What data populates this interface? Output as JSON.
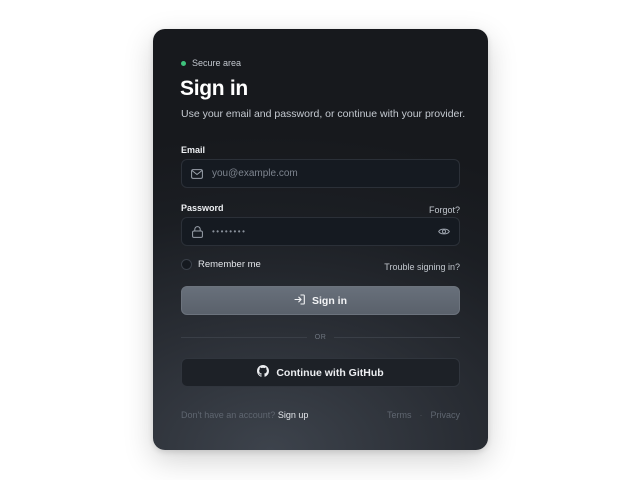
{
  "badge": {
    "text": "Secure area",
    "color": "#3ec27c"
  },
  "heading": {
    "title": "Sign in",
    "subtitle": "Use your email and password, or continue with your provider."
  },
  "email": {
    "label": "Email",
    "placeholder": "you@example.com",
    "value": "",
    "icon": "mail-icon"
  },
  "password": {
    "label": "Password",
    "forgot": "Forgot?",
    "masked": "••••••••",
    "icon": "lock-icon",
    "toggle_icon": "eye-icon"
  },
  "options": {
    "remember": "Remember me",
    "trouble": "Trouble signing in?"
  },
  "primary": {
    "label": "Sign in",
    "icon": "sign-in-icon"
  },
  "divider": {
    "text": "OR"
  },
  "github": {
    "label": "Continue with GitHub",
    "icon": "github-icon"
  },
  "footer": {
    "prompt": "Don't have an account?",
    "signup": "Sign up",
    "terms": "Terms",
    "separator": "·",
    "privacy": "Privacy"
  }
}
